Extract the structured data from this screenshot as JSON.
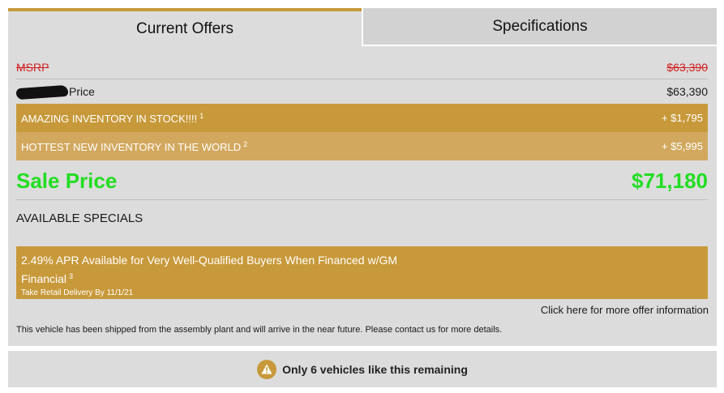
{
  "tabs": {
    "current_offers": "Current Offers",
    "specifications": "Specifications"
  },
  "pricing": {
    "msrp_label": "MSRP",
    "msrp_value": "$63,390",
    "price_label": "Price",
    "price_value": "$63,390",
    "addons": [
      {
        "label": "AMAZING INVENTORY IN STOCK!!!!",
        "footnote": "1",
        "value": "+ $1,795"
      },
      {
        "label": "HOTTEST NEW INVENTORY IN THE WORLD",
        "footnote": "2",
        "value": "+ $5,995"
      }
    ],
    "sale_label": "Sale Price",
    "sale_value": "$71,180"
  },
  "specials": {
    "heading": "AVAILABLE SPECIALS",
    "offer_title": "2.49% APR Available for Very Well-Qualified Buyers When Financed w/GM Financial",
    "offer_footnote": "3",
    "offer_subtitle": "Take Retail Delivery By 11/1/21",
    "more_link": "Click here for more offer information"
  },
  "shipping_note": "This vehicle has been shipped from the assembly plant and will arrive in the near future. Please contact us for more details.",
  "availability": {
    "text": "Only 6 vehicles like this remaining",
    "icon": "warning-icon"
  },
  "colors": {
    "gold": "#c8993a",
    "gold_light": "#d2a85e",
    "sale_green": "#22dd22",
    "msrp_red": "#d12020"
  }
}
